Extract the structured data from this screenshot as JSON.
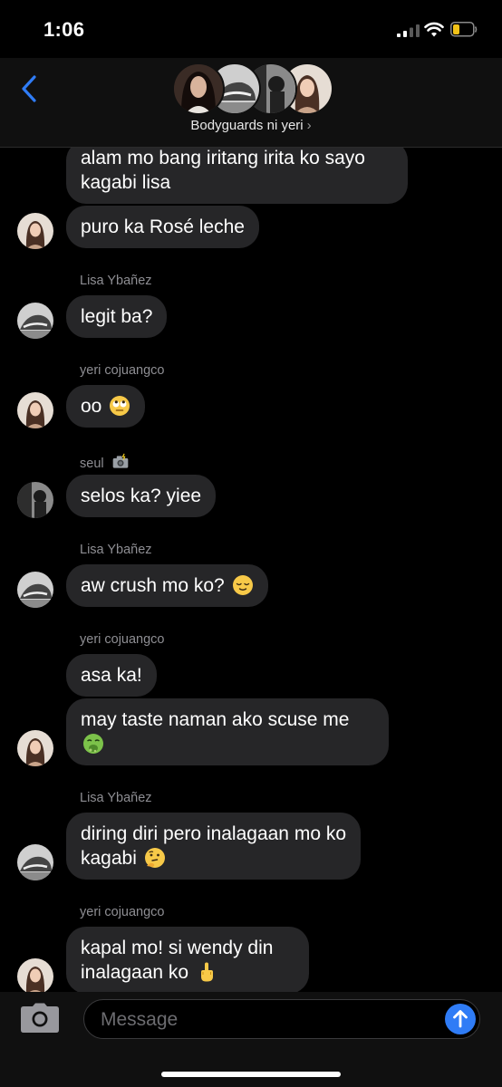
{
  "status_bar": {
    "time": "1:06"
  },
  "header": {
    "group_name": "Bodyguards ni yeri",
    "chevron": "›",
    "back_icon": "chevron-left-icon"
  },
  "messages": [
    {
      "type": "bubble",
      "text": "alam mo bang iritang irita ko sayo kagabi lisa"
    },
    {
      "type": "bubble",
      "text": "puro ka Rosé leche"
    },
    {
      "type": "sender",
      "text": "Lisa Ybañez"
    },
    {
      "type": "bubble",
      "text": "legit ba?"
    },
    {
      "type": "sender",
      "text": "yeri cojuangco"
    },
    {
      "type": "bubble",
      "text": "oo",
      "emoji": "eye-roll-emoji"
    },
    {
      "type": "sender",
      "text": "seul",
      "emoji": "camera-flash-emoji"
    },
    {
      "type": "bubble",
      "text": "selos ka? yiee"
    },
    {
      "type": "sender",
      "text": "Lisa Ybañez"
    },
    {
      "type": "bubble",
      "text": "aw crush mo ko?",
      "emoji": "relieved-face-emoji"
    },
    {
      "type": "sender",
      "text": "yeri cojuangco"
    },
    {
      "type": "bubble",
      "text": "asa ka!"
    },
    {
      "type": "bubble",
      "text": "may taste naman ako scuse me",
      "emoji": "vomiting-face-emoji"
    },
    {
      "type": "sender",
      "text": "Lisa Ybañez"
    },
    {
      "type": "bubble",
      "text": "diring diri pero inalagaan mo ko kagabi",
      "emoji": "thinking-face-emoji"
    },
    {
      "type": "sender",
      "text": "yeri cojuangco"
    },
    {
      "type": "bubble",
      "text": "kapal mo! si wendy din inalagaan ko",
      "emoji": "middle-finger-emoji"
    }
  ],
  "input": {
    "placeholder": "Message",
    "camera_icon": "camera-icon",
    "send_icon": "arrow-up-icon"
  },
  "colors": {
    "background": "#000000",
    "bubble": "#262628",
    "sender_text": "#8e8e93",
    "accent": "#2f7cf6",
    "battery_low": "#f2c218"
  }
}
